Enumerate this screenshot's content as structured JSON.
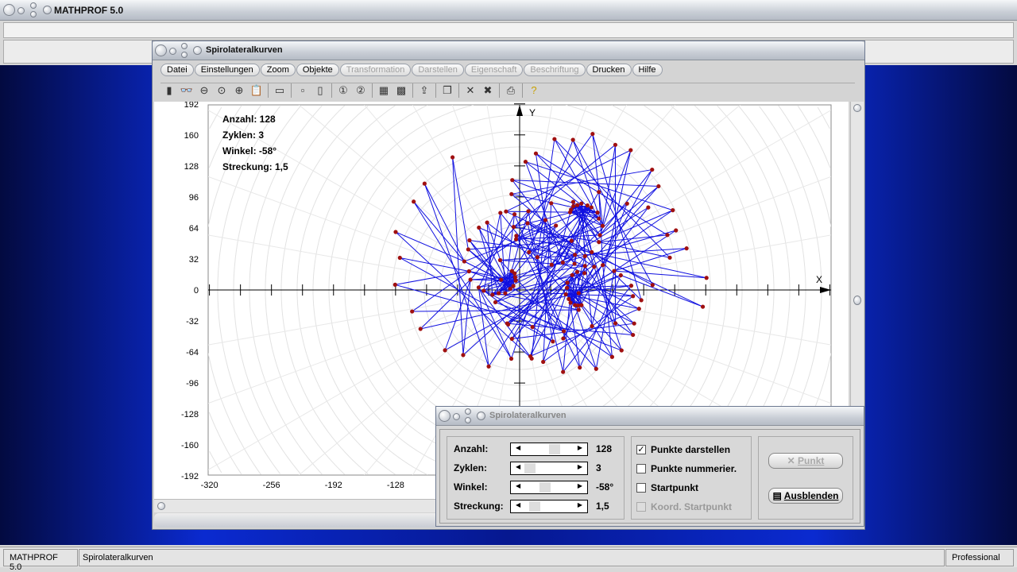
{
  "app": {
    "title": "MATHPROF 5.0"
  },
  "window": {
    "title": "Spirolateralkurven",
    "menu": [
      {
        "label": "Datei",
        "enabled": true
      },
      {
        "label": "Einstellungen",
        "enabled": true
      },
      {
        "label": "Zoom",
        "enabled": true
      },
      {
        "label": "Objekte",
        "enabled": true
      },
      {
        "label": "Transformation",
        "enabled": false
      },
      {
        "label": "Darstellen",
        "enabled": false
      },
      {
        "label": "Eigenschaft",
        "enabled": false
      },
      {
        "label": "Beschriftung",
        "enabled": false
      },
      {
        "label": "Drucken",
        "enabled": true
      },
      {
        "label": "Hilfe",
        "enabled": true
      }
    ],
    "toolbar": [
      "window-icon",
      "glasses-icon",
      "zoom-out-icon",
      "zoom-reset-icon",
      "zoom-in-icon",
      "clipboard-icon",
      "|",
      "window-layout-icon",
      "|",
      "box-icon",
      "boxes-icon",
      "|",
      "circle-1-icon",
      "circle-2-icon",
      "|",
      "table-icon",
      "copy-image-icon",
      "|",
      "export-icon",
      "|",
      "pages-icon",
      "|",
      "cross-icon",
      "cross-double-icon",
      "|",
      "print-icon",
      "|",
      "help-icon"
    ]
  },
  "graph": {
    "info": [
      "Anzahl: 128",
      "Zyklen: 3",
      "Winkel: -58°",
      "Streckung: 1,5"
    ],
    "x_axis_label": "X",
    "y_axis_label": "Y",
    "y_ticks": [
      "192",
      "160",
      "128",
      "96",
      "64",
      "32",
      "0",
      "-32",
      "-64",
      "-96",
      "-128",
      "-160",
      "-192"
    ],
    "x_ticks": [
      "-320",
      "-256",
      "-192",
      "-128"
    ],
    "point_color": "#a01010",
    "line_color": "#1010e0"
  },
  "dialog": {
    "title": "Spirolateralkurven",
    "params": [
      {
        "label": "Anzahl:",
        "value": "128",
        "pos": 0.55
      },
      {
        "label": "Zyklen:",
        "value": "3",
        "pos": 0.05
      },
      {
        "label": "Winkel:",
        "value": "-58°",
        "pos": 0.35
      },
      {
        "label": "Streckung:",
        "value": "1,5",
        "pos": 0.15
      }
    ],
    "checks": [
      {
        "label": "Punkte darstellen",
        "checked": true,
        "enabled": true
      },
      {
        "label": "Punkte nummerier.",
        "checked": false,
        "enabled": true
      },
      {
        "label": "Startpunkt",
        "checked": false,
        "enabled": true
      },
      {
        "label": "Koord. Startpunkt",
        "checked": false,
        "enabled": false
      }
    ],
    "punkt_button": "Punkt",
    "ausblenden_button": "Ausblenden"
  },
  "status": {
    "app": "MATHPROF 5.0",
    "module": "Spirolateralkurven",
    "edition": "Professional"
  }
}
